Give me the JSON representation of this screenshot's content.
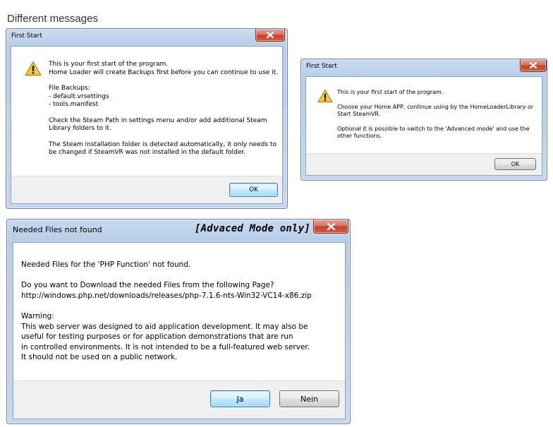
{
  "page_title": "Different messages",
  "dialog1": {
    "title": "First Start",
    "lines": [
      "This is your first start of the program.",
      "Home Loader will create Backups first before you can continue to use it.",
      "",
      "File Backups:",
      "- default.vrsettings",
      "- tools.manifest",
      "",
      "Check the Steam Path in settings menu and/or add additional Steam",
      "Library folders to it.",
      "",
      "The Steam installation folder is detected automatically, it only needs to",
      "be changed if SteamVR was not installed in the default folder."
    ],
    "ok_label": "OK"
  },
  "dialog2": {
    "title": "First Start",
    "lines": [
      "This is your first start of the program.",
      "",
      "Choose your Home APP, continue using by the HomeLoaderLibrary or",
      "Start SteamVR.",
      "",
      "Optional it is possible to switch to the 'Advanced mode' and use the",
      "other functions."
    ],
    "ok_label": "OK"
  },
  "dialog3": {
    "title": "Needed Files not found",
    "badge": "[Advaced Mode only]",
    "lines": [
      "Needed Files for the 'PHP Function' not found.",
      "",
      "Do you want to Download the needed Files from the following Page?",
      "http://windows.php.net/downloads/releases/php-7.1.6-nts-Win32-VC14-x86.zip",
      "",
      "Warning:",
      "This web server was designed to aid application development. It may also be",
      "useful for testing purposes or for application demonstrations that are run",
      "in controlled environments. It is not intended to be a full-featured web server.",
      "It should not be used on a public network."
    ],
    "yes_label": "Ja",
    "no_label": "Nein"
  },
  "icons": {
    "warning": "warning-icon",
    "close": "close-icon"
  },
  "colors": {
    "frame": "#b8cde8",
    "close_red": "#c4412a",
    "warning_yellow": "#f6c64a"
  }
}
